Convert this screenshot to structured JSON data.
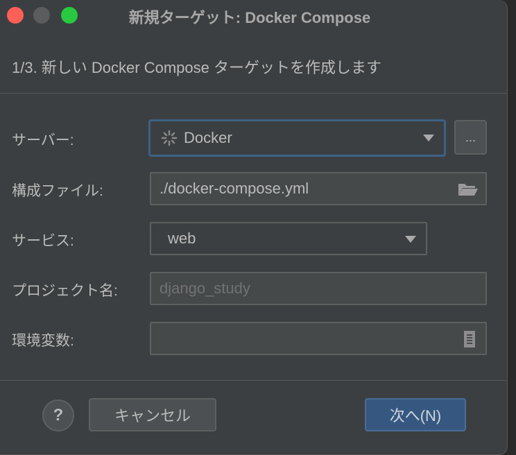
{
  "window": {
    "title": "新規ターゲット: Docker Compose",
    "controls": {
      "close": "#fe5f57",
      "minimize": "#5a5c5e",
      "maximize": "#28c840"
    }
  },
  "subtitle": "1/3. 新しい Docker Compose ターゲットを作成します",
  "form": {
    "server": {
      "label": "サーバー:",
      "value": "Docker",
      "icon": "loading-spinner-icon",
      "more_label": "..."
    },
    "config_file": {
      "label": "構成ファイル:",
      "value": "./docker-compose.yml",
      "icon": "folder-icon"
    },
    "service": {
      "label": "サービス:",
      "value": "web"
    },
    "project_name": {
      "label": "プロジェクト名:",
      "placeholder": "django_study"
    },
    "env_vars": {
      "label": "環境変数:",
      "value": "",
      "icon": "document-icon"
    }
  },
  "footer": {
    "help_label": "?",
    "cancel_label": "キャンセル",
    "next_label": "次へ(N)"
  },
  "colors": {
    "accent": "#365880",
    "focus": "#3d6185",
    "background": "#3c3f41"
  }
}
